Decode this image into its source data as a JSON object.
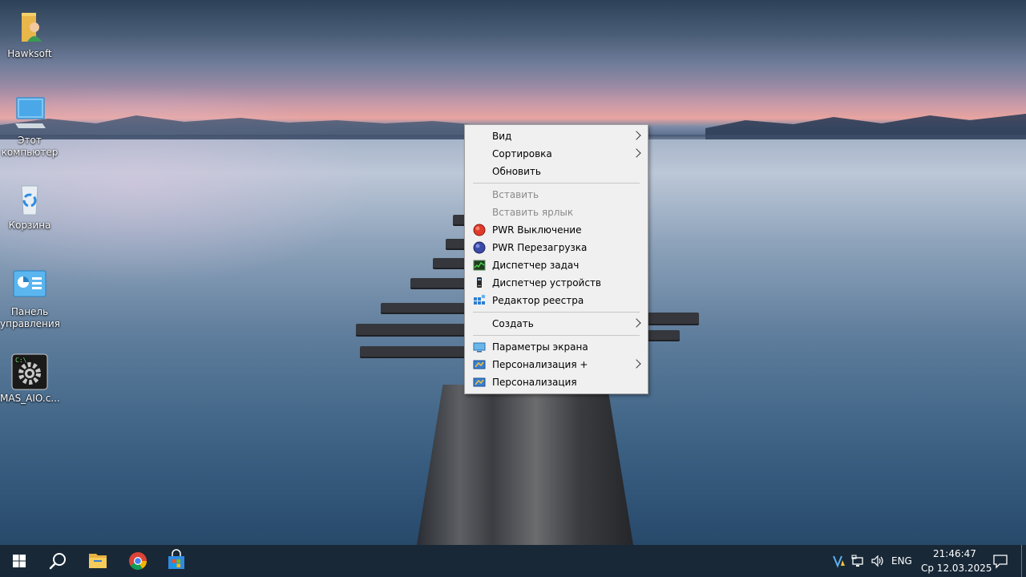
{
  "desktop_icons": {
    "hawksoft": "Hawksoft",
    "this_pc_line1": "Этот",
    "this_pc_line2": "компьютер",
    "recycle_bin": "Корзина",
    "control_panel_line1": "Панель",
    "control_panel_line2": "управления",
    "mas_aio": "MAS_AIO.c..."
  },
  "context_menu": {
    "view": "Вид",
    "sort": "Сортировка",
    "refresh": "Обновить",
    "paste": "Вставить",
    "paste_shortcut": "Вставить ярлык",
    "pwr_shutdown": "PWR Выключение",
    "pwr_restart": "PWR Перезагрузка",
    "task_manager": "Диспетчер задач",
    "device_manager": "Диспетчер устройств",
    "registry_editor": "Редактор реестра",
    "create": "Создать",
    "display_settings": "Параметры экрана",
    "personalization_plus": "Персонализация +",
    "personalization": "Персонализация"
  },
  "taskbar": {
    "language": "ENG",
    "time": "21:46:47",
    "date": "Ср 12.03.2025"
  },
  "icons": {
    "start": "windows-start-icon",
    "search": "search-icon",
    "explorer": "file-explorer-icon",
    "chrome": "chrome-icon",
    "store": "store-icon",
    "notifications": "notification-icon"
  },
  "colors": {
    "menu_background": "#f0f0f0",
    "taskbar": "#182634",
    "disabled_text": "#8a8a8a"
  }
}
